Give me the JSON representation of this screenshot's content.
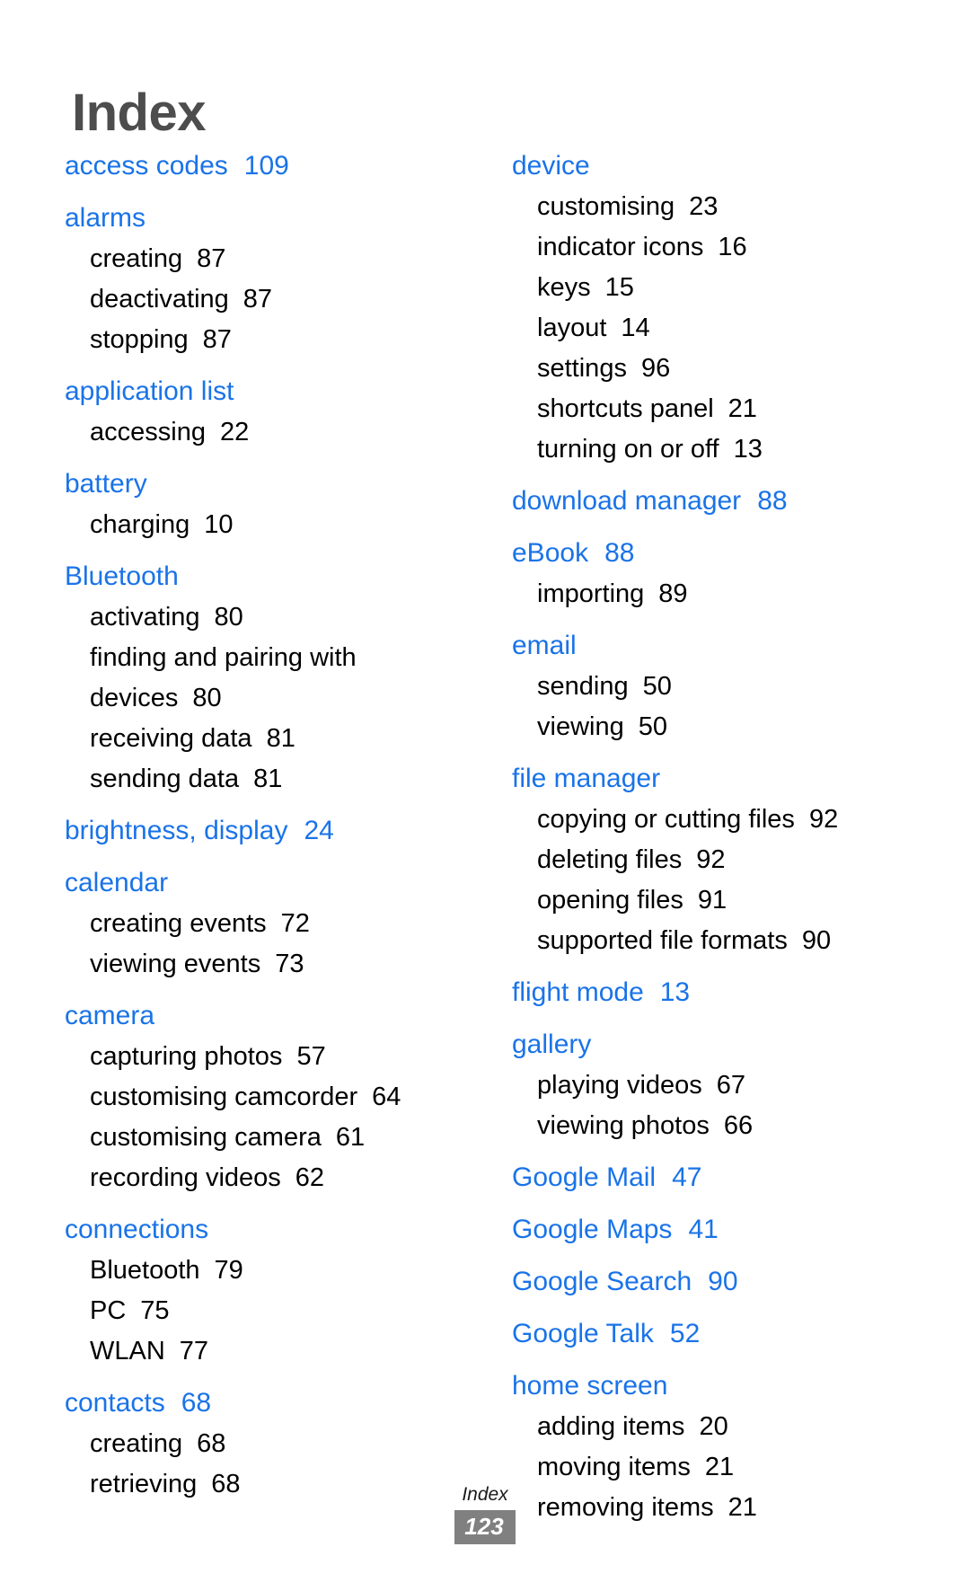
{
  "page": {
    "title": "Index",
    "title_color": "#4d4d4d",
    "headword_color": "#1a73e8",
    "subentry_color": "#000000"
  },
  "footer": {
    "label": "Index",
    "page_number": "123"
  },
  "columns": [
    {
      "name": "left",
      "groups": [
        {
          "term": "access codes",
          "page": "109",
          "subentries": []
        },
        {
          "term": "alarms",
          "page": "",
          "subentries": [
            {
              "label": "creating",
              "page": "87"
            },
            {
              "label": "deactivating",
              "page": "87"
            },
            {
              "label": "stopping",
              "page": "87"
            }
          ]
        },
        {
          "term": "application list",
          "page": "",
          "subentries": [
            {
              "label": "accessing",
              "page": "22"
            }
          ]
        },
        {
          "term": "battery",
          "page": "",
          "subentries": [
            {
              "label": "charging",
              "page": "10"
            }
          ]
        },
        {
          "term": "Bluetooth",
          "page": "",
          "subentries": [
            {
              "label": "activating",
              "page": "80"
            },
            {
              "label": "finding and pairing with devices",
              "page": "80"
            },
            {
              "label": "receiving data",
              "page": "81"
            },
            {
              "label": "sending data",
              "page": "81"
            }
          ]
        },
        {
          "term": "brightness, display",
          "page": "24",
          "subentries": []
        },
        {
          "term": "calendar",
          "page": "",
          "subentries": [
            {
              "label": "creating events",
              "page": "72"
            },
            {
              "label": "viewing events",
              "page": "73"
            }
          ]
        },
        {
          "term": "camera",
          "page": "",
          "subentries": [
            {
              "label": "capturing photos",
              "page": "57"
            },
            {
              "label": "customising camcorder",
              "page": "64"
            },
            {
              "label": "customising camera",
              "page": "61"
            },
            {
              "label": "recording videos",
              "page": "62"
            }
          ]
        },
        {
          "term": "connections",
          "page": "",
          "subentries": [
            {
              "label": "Bluetooth",
              "page": "79"
            },
            {
              "label": "PC",
              "page": "75"
            },
            {
              "label": "WLAN",
              "page": "77"
            }
          ]
        },
        {
          "term": "contacts",
          "page": "68",
          "subentries": [
            {
              "label": "creating",
              "page": "68"
            },
            {
              "label": "retrieving",
              "page": "68"
            }
          ]
        }
      ]
    },
    {
      "name": "right",
      "groups": [
        {
          "term": "device",
          "page": "",
          "subentries": [
            {
              "label": "customising",
              "page": "23"
            },
            {
              "label": "indicator icons",
              "page": "16"
            },
            {
              "label": "keys",
              "page": "15"
            },
            {
              "label": "layout",
              "page": "14"
            },
            {
              "label": "settings",
              "page": "96"
            },
            {
              "label": "shortcuts panel",
              "page": "21"
            },
            {
              "label": "turning on or off",
              "page": "13"
            }
          ]
        },
        {
          "term": "download manager",
          "page": "88",
          "subentries": []
        },
        {
          "term": "eBook",
          "page": "88",
          "subentries": [
            {
              "label": "importing",
              "page": "89"
            }
          ]
        },
        {
          "term": "email",
          "page": "",
          "subentries": [
            {
              "label": "sending",
              "page": "50"
            },
            {
              "label": "viewing",
              "page": "50"
            }
          ]
        },
        {
          "term": "file manager",
          "page": "",
          "subentries": [
            {
              "label": "copying or cutting files",
              "page": "92"
            },
            {
              "label": "deleting files",
              "page": "92"
            },
            {
              "label": "opening files",
              "page": "91"
            },
            {
              "label": "supported file formats",
              "page": "90"
            }
          ]
        },
        {
          "term": "flight mode",
          "page": "13",
          "subentries": []
        },
        {
          "term": "gallery",
          "page": "",
          "subentries": [
            {
              "label": "playing videos",
              "page": "67"
            },
            {
              "label": "viewing photos",
              "page": "66"
            }
          ]
        },
        {
          "term": "Google Mail",
          "page": "47",
          "subentries": []
        },
        {
          "term": "Google Maps",
          "page": "41",
          "subentries": []
        },
        {
          "term": "Google Search",
          "page": "90",
          "subentries": []
        },
        {
          "term": "Google Talk",
          "page": "52",
          "subentries": []
        },
        {
          "term": "home screen",
          "page": "",
          "subentries": [
            {
              "label": "adding items",
              "page": "20"
            },
            {
              "label": "moving items",
              "page": "21"
            },
            {
              "label": "removing items",
              "page": "21"
            }
          ]
        }
      ]
    }
  ]
}
